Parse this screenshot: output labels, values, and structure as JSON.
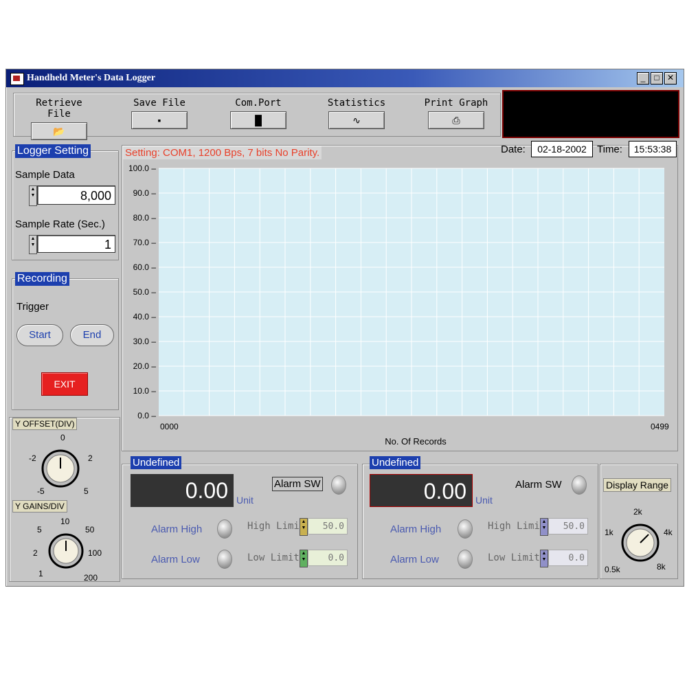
{
  "window": {
    "title": "Handheld Meter's Data Logger",
    "controls": {
      "minimize": "_",
      "maximize": "□",
      "close": "✕"
    }
  },
  "toolbar": {
    "items": [
      {
        "label": "Retrieve File",
        "icon": "open-folder-icon",
        "glyph": "📂"
      },
      {
        "label": "Save File",
        "icon": "floppy-disk-icon",
        "glyph": "▪"
      },
      {
        "label": "Com.Port",
        "icon": "port-connector-icon",
        "glyph": "▐▌"
      },
      {
        "label": "Statistics",
        "icon": "statistics-icon",
        "glyph": "∿"
      },
      {
        "label": "Print Graph",
        "icon": "printer-icon",
        "glyph": "⎙"
      }
    ]
  },
  "logger_setting": {
    "title": "Logger Setting",
    "sample_data_label": "Sample Data",
    "sample_data_value": "8,000",
    "sample_rate_label": "Sample Rate (Sec.)",
    "sample_rate_value": "1"
  },
  "recording": {
    "title": "Recording",
    "trigger_label": "Trigger",
    "start_label": "Start",
    "end_label": "End",
    "exit_label": "EXIT"
  },
  "y_offset": {
    "title": "Y OFFSET(DIV)",
    "ticks": [
      "0",
      "-2",
      "2",
      "-5",
      "5"
    ]
  },
  "y_gains": {
    "title": "Y GAINS/DIV",
    "ticks": [
      "10",
      "5",
      "50",
      "2",
      "100",
      "1",
      "200"
    ]
  },
  "status": {
    "setting_text": "Setting: COM1, 1200 Bps, 7 bits No Parity.",
    "date_label": "Date:",
    "date_value": "02-18-2002",
    "time_label": "Time:",
    "time_value": "15:53:38"
  },
  "chart_data": {
    "type": "line",
    "title": "",
    "xlabel": "No. Of Records",
    "ylabel": "",
    "xlim": [
      0,
      499
    ],
    "x_tick_labels": [
      "0000",
      "0499"
    ],
    "ylim": [
      0,
      100
    ],
    "y_ticks": [
      "100.0",
      "90.0",
      "80.0",
      "70.0",
      "60.0",
      "50.0",
      "40.0",
      "30.0",
      "20.0",
      "10.0",
      "0.0"
    ],
    "grid": true,
    "series": [],
    "colors": {
      "background": "#d7eef5",
      "grid": "#ffffff"
    }
  },
  "channels": [
    {
      "title": "Undefined",
      "value": "0.00",
      "unit": "Unit",
      "alarm_sw_label": "Alarm SW",
      "alarm_high_label": "Alarm High",
      "alarm_low_label": "Alarm Low",
      "high_limit_label": "High Limit",
      "high_limit_value": "50.0",
      "low_limit_label": "Low Limit",
      "low_limit_value": "0.0",
      "spinner_color": "#c8b050",
      "field_color": "#e8f0d8"
    },
    {
      "title": "Undefined",
      "value": "0.00",
      "unit": "Unit",
      "alarm_sw_label": "Alarm SW",
      "alarm_high_label": "Alarm High",
      "alarm_low_label": "Alarm Low",
      "high_limit_label": "High Limit",
      "high_limit_value": "50.0",
      "low_limit_label": "Low Limit",
      "low_limit_value": "0.0",
      "spinner_color": "#9090c8",
      "field_color": "#e6e6ee"
    }
  ],
  "display_range": {
    "title": "Display Range",
    "ticks": [
      "2k",
      "1k",
      "4k",
      "0.5k",
      "8k"
    ]
  }
}
